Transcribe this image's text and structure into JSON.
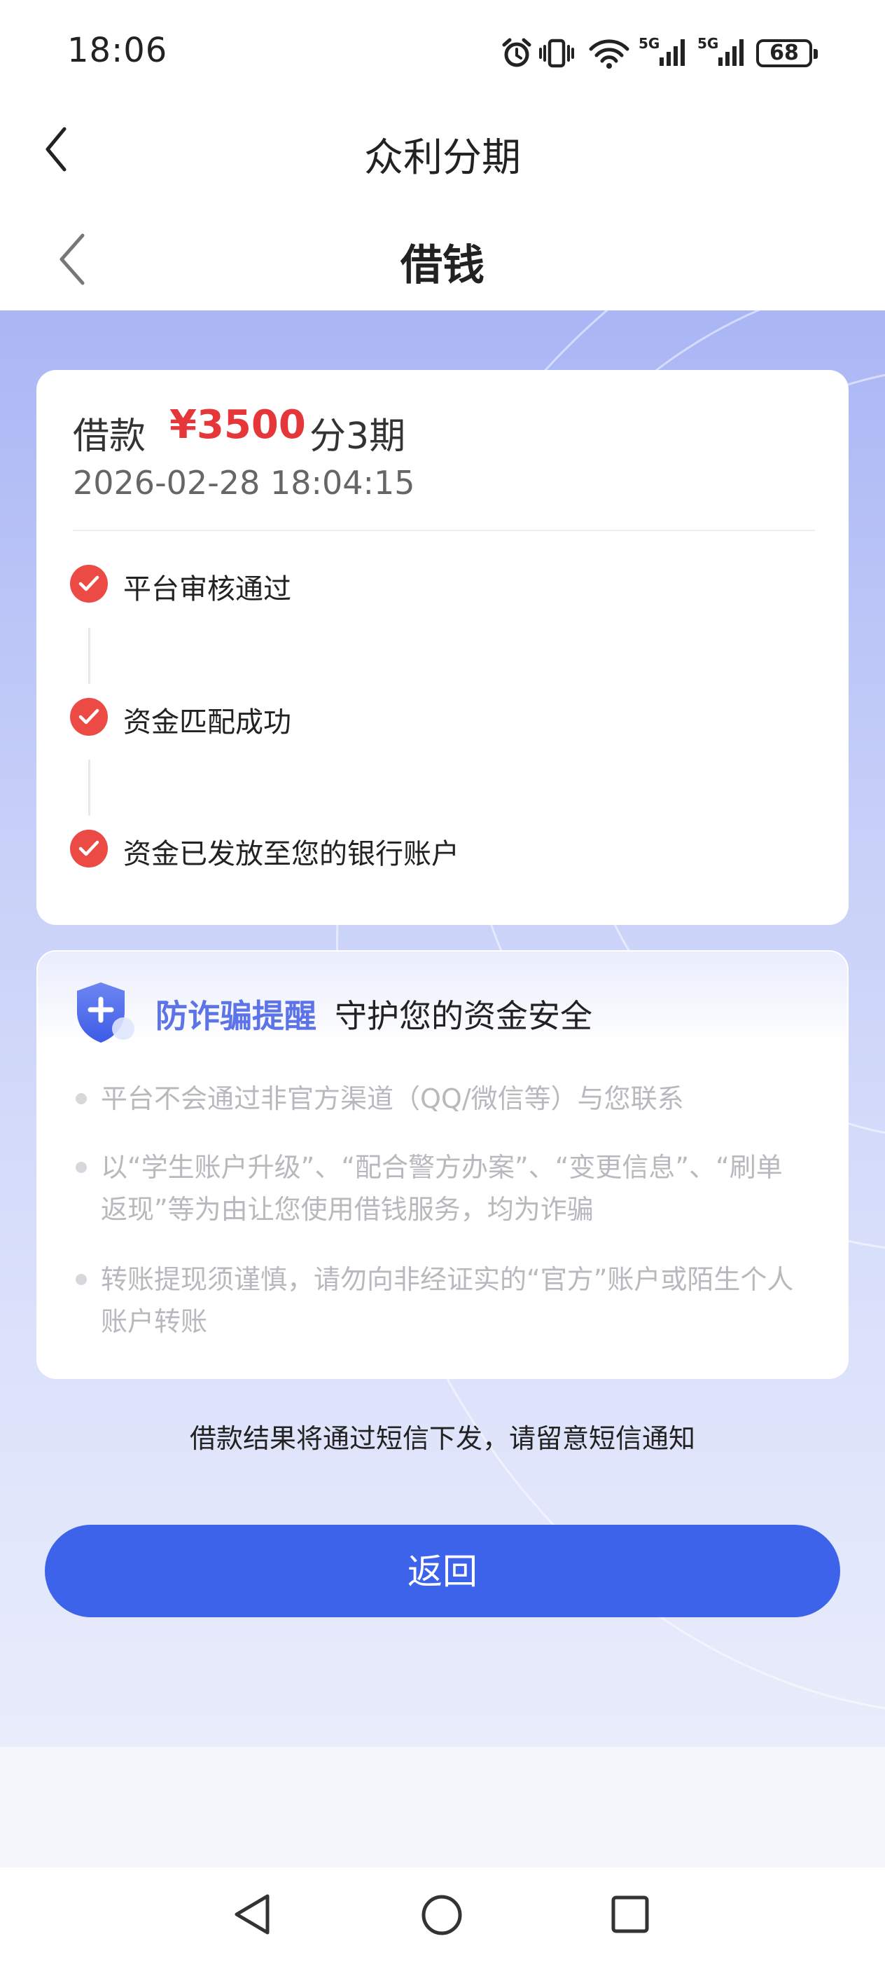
{
  "status_bar": {
    "time": "18:06",
    "icons": [
      "alarm-icon",
      "vibrate-icon",
      "wifi-icon",
      "signal-5g-icon",
      "signal-5g-icon"
    ],
    "network_1": "5G",
    "network_2": "5G",
    "battery": "68"
  },
  "app_header": {
    "title": "众利分期",
    "back_icon": "chevron-left-icon"
  },
  "page_header": {
    "title": "借钱",
    "back_icon": "chevron-left-icon"
  },
  "loan": {
    "label": "借款",
    "amount": "¥3500",
    "term": "分3期",
    "timestamp": "2026-02-28 18:04:15"
  },
  "steps": [
    {
      "label": "平台审核通过",
      "status": "done"
    },
    {
      "label": "资金匹配成功",
      "status": "done"
    },
    {
      "label": "资金已发放至您的银行账户",
      "status": "done"
    }
  ],
  "anti_fraud": {
    "title": "防诈骗提醒",
    "subtitle": "守护您的资金安全",
    "icon": "shield-icon",
    "tips": [
      "平台不会通过非官方渠道（QQ/微信等）与您联系",
      "以“学生账户升级”、“配合警方办案”、“变更信息”、“刷单返现”等为由让您使用借钱服务，均为诈骗",
      "转账提现须谨慎，请勿向非经证实的“官方”账户或陌生个人账户转账"
    ]
  },
  "notice": "借款结果将通过短信下发，请留意短信通知",
  "return_button": "返回",
  "nav_bar": {
    "icons": [
      "back-triangle-icon",
      "home-circle-icon",
      "recents-square-icon"
    ]
  },
  "colors": {
    "accent": "#3d63ea",
    "amount": "#e5373a",
    "check": "#ec4a45",
    "warn_title": "#5d73e8"
  }
}
